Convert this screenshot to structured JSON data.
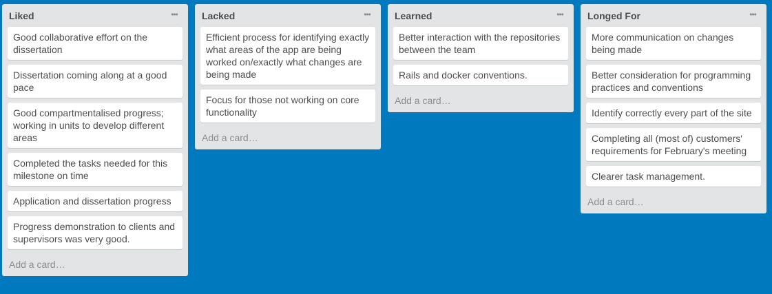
{
  "lists": [
    {
      "title": "Liked",
      "menu_icon": "ellipsis-icon",
      "cards": [
        "Good collaborative effort on the dissertation",
        "Dissertation coming along at a good pace",
        "Good compartmentalised progress; working in units to develop different areas",
        "Completed the tasks needed for this milestone on time",
        "Application and dissertation progress",
        "Progress demonstration to clients and supervisors was very good."
      ],
      "add_card": "Add a card…"
    },
    {
      "title": "Lacked",
      "menu_icon": "ellipsis-icon",
      "cards": [
        "Efficient process for identifying exactly what areas of the app are being worked on/exactly what changes are being made",
        "Focus for those not working on core functionality"
      ],
      "add_card": "Add a card…"
    },
    {
      "title": "Learned",
      "menu_icon": "ellipsis-icon",
      "cards": [
        "Better interaction with the repositories between the team",
        "Rails and docker conventions."
      ],
      "add_card": "Add a card…"
    },
    {
      "title": "Longed For",
      "menu_icon": "ellipsis-icon",
      "cards": [
        "More communication on changes being made",
        "Better consideration for programming practices and conventions",
        "Identify correctly every part of the site",
        "Completing all (most of) customers' requirements for February's meeting",
        "Clearer task management."
      ],
      "add_card": "Add a card…"
    }
  ],
  "colors": {
    "board_background": "#0079bf",
    "list_background": "#e2e4e6",
    "card_background": "#ffffff",
    "text": "#4d4d4d",
    "muted_text": "#8c8c8c"
  }
}
